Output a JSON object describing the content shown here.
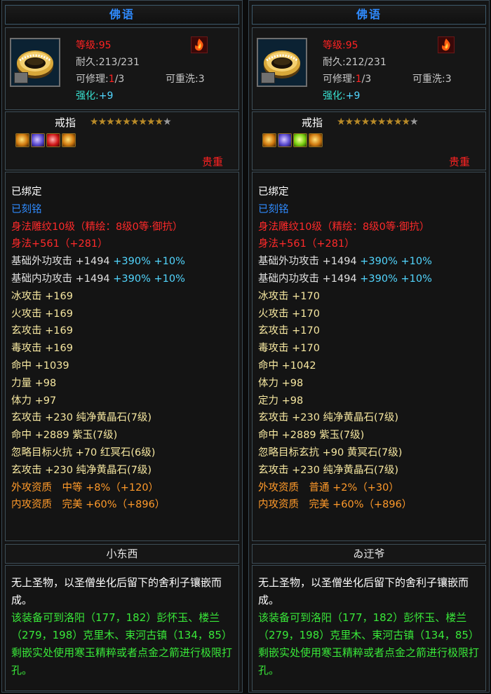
{
  "panels": [
    {
      "title": "佛语",
      "level_label": "等级:95",
      "durability": "耐久:213/231",
      "repair_label": "可修理:",
      "repair_count": "1",
      "repair_total": "/3",
      "rewash": "可重洗:3",
      "enhance_label": "强化:",
      "enhance_value": "+9",
      "item_type": "戒指",
      "stars_filled": 9,
      "stars_total": 10,
      "gems": [
        "gem-amber",
        "gem-purple",
        "gem-red",
        "gem-amber"
      ],
      "grade": "贵重",
      "stats": [
        {
          "text": "已绑定",
          "color": "white"
        },
        {
          "text": "已刻铭",
          "color": "blue"
        },
        {
          "text": "身法雕纹10级（精绘：8级0等·御抗）",
          "color": "red"
        },
        {
          "text": "身法+561（+281）",
          "color": "red"
        },
        {
          "parts": [
            {
              "text": "基础外功攻击 +1494 ",
              "color": "gray"
            },
            {
              "text": "+390% +10%",
              "color": "cyan"
            }
          ]
        },
        {
          "parts": [
            {
              "text": "基础内功攻击 +1494 ",
              "color": "gray"
            },
            {
              "text": "+390% +10%",
              "color": "cyan"
            }
          ]
        },
        {
          "text": "冰攻击 +169",
          "color": "yellow"
        },
        {
          "text": "火攻击 +169",
          "color": "yellow"
        },
        {
          "text": "玄攻击 +169",
          "color": "yellow"
        },
        {
          "text": "毒攻击 +169",
          "color": "yellow"
        },
        {
          "text": "命中 +1039",
          "color": "yellow"
        },
        {
          "text": "力量 +98",
          "color": "yellow"
        },
        {
          "text": "体力 +97",
          "color": "yellow"
        },
        {
          "text": "玄攻击 +230 纯净黄晶石(7级)",
          "color": "yellow"
        },
        {
          "text": "命中 +2889 紫玉(7级)",
          "color": "yellow"
        },
        {
          "text": "忽略目标火抗 +70 红冥石(6级)",
          "color": "yellow"
        },
        {
          "text": "玄攻击 +230 纯净黄晶石(7级)",
          "color": "yellow"
        },
        {
          "text": "外攻资质　中等 +8%（+120）",
          "color": "orange"
        },
        {
          "text": "内攻资质　完美 +60%（+896）",
          "color": "orange"
        }
      ],
      "maker": "小东西",
      "desc_white": "无上圣物，以圣僧坐化后留下的舍利子镶嵌而成。",
      "desc_green": "该装备可到洛阳（177，182）彭怀玉、楼兰（279，198）克里木、束河古镇（134，85）剩嵌实处使用寒玉精粹或者点金之箭进行极限打孔。"
    },
    {
      "title": "佛语",
      "level_label": "等级:95",
      "durability": "耐久:212/231",
      "repair_label": "可修理:",
      "repair_count": "1",
      "repair_total": "/3",
      "rewash": "可重洗:3",
      "enhance_label": "强化:",
      "enhance_value": "+9",
      "item_type": "戒指",
      "stars_filled": 9,
      "stars_total": 10,
      "gems": [
        "gem-amber",
        "gem-purple",
        "gem-green",
        "gem-amber"
      ],
      "grade": "贵重",
      "stats": [
        {
          "text": "已绑定",
          "color": "white"
        },
        {
          "text": "已刻铭",
          "color": "blue"
        },
        {
          "text": "身法雕纹10级（精绘：8级0等·御抗）",
          "color": "red"
        },
        {
          "text": "身法+561（+281）",
          "color": "red"
        },
        {
          "parts": [
            {
              "text": "基础外功攻击 +1494 ",
              "color": "gray"
            },
            {
              "text": "+390% +10%",
              "color": "cyan"
            }
          ]
        },
        {
          "parts": [
            {
              "text": "基础内功攻击 +1494 ",
              "color": "gray"
            },
            {
              "text": "+390% +10%",
              "color": "cyan"
            }
          ]
        },
        {
          "text": "冰攻击 +170",
          "color": "yellow"
        },
        {
          "text": "火攻击 +170",
          "color": "yellow"
        },
        {
          "text": "玄攻击 +170",
          "color": "yellow"
        },
        {
          "text": "毒攻击 +170",
          "color": "yellow"
        },
        {
          "text": "命中 +1042",
          "color": "yellow"
        },
        {
          "text": "体力 +98",
          "color": "yellow"
        },
        {
          "text": "定力 +98",
          "color": "yellow"
        },
        {
          "text": "玄攻击 +230 纯净黄晶石(7级)",
          "color": "yellow"
        },
        {
          "text": "命中 +2889 紫玉(7级)",
          "color": "yellow"
        },
        {
          "text": "忽略目标玄抗 +90 黄冥石(7级)",
          "color": "yellow"
        },
        {
          "text": "玄攻击 +230 纯净黄晶石(7级)",
          "color": "yellow"
        },
        {
          "text": "外攻资质　普通 +2%（+30）",
          "color": "orange"
        },
        {
          "text": "内攻资质　完美 +60%（+896）",
          "color": "orange"
        }
      ],
      "maker": "ゐ迂爷",
      "desc_white": "无上圣物，以圣僧坐化后留下的舍利子镶嵌而成。",
      "desc_green": "该装备可到洛阳（177，182）彭怀玉、楼兰（279，198）克里木、束河古镇（134，85）剩嵌实处使用寒玉精粹或者点金之箭进行极限打孔。"
    }
  ],
  "colors": {
    "title_blue": "#2f8bff",
    "red": "#ff2222",
    "yellow": "#f6e7a0",
    "orange": "#ff9a2a",
    "cyan": "#52d6ff",
    "green": "#39e839"
  },
  "icons": {
    "item_icon": "gold-ring-icon",
    "level_badge": "flame-badge-icon"
  }
}
